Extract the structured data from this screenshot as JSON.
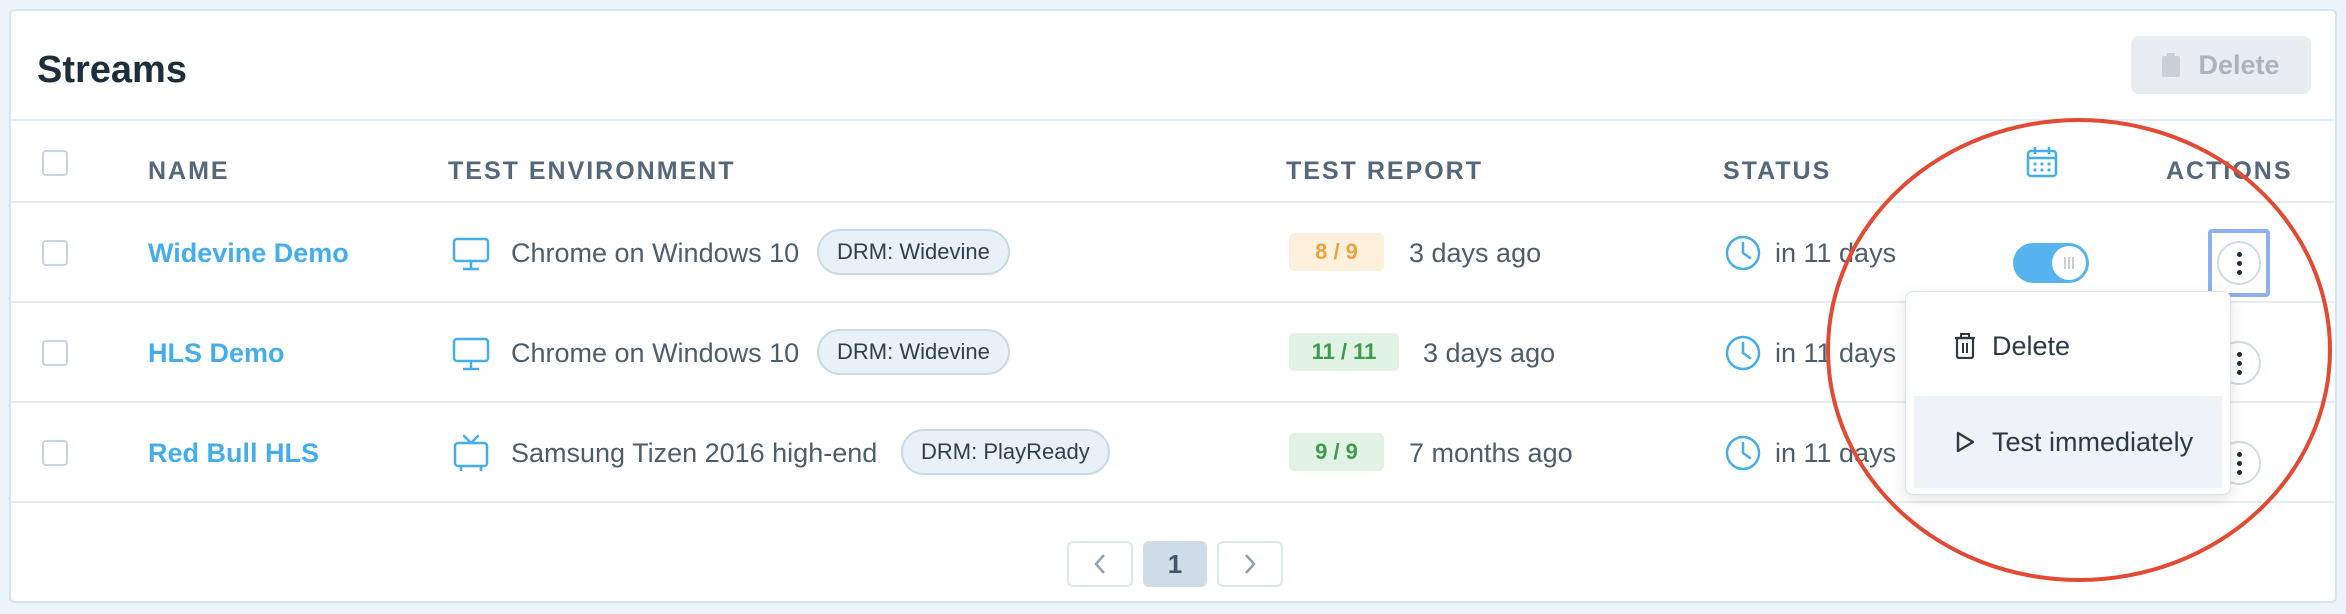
{
  "panel": {
    "title": "Streams",
    "delete_label": "Delete"
  },
  "columns": {
    "name": "NAME",
    "env": "TEST ENVIRONMENT",
    "report": "TEST REPORT",
    "status": "STATUS",
    "actions": "ACTIONS"
  },
  "rows": [
    {
      "name": "Widevine Demo",
      "env_icon": "monitor-icon",
      "env": "Chrome on Windows 10",
      "drm": "DRM: Widevine",
      "score": "8 / 9",
      "score_state": "warning",
      "ago": "3 days ago",
      "status": "in 11 days"
    },
    {
      "name": "HLS Demo",
      "env_icon": "monitor-icon",
      "env": "Chrome on Windows 10",
      "drm": "DRM: Widevine",
      "score": "11 / 11",
      "score_state": "pass",
      "ago": "3 days ago",
      "status": "in 11 days"
    },
    {
      "name": "Red Bull HLS",
      "env_icon": "tv-icon",
      "env": "Samsung Tizen 2016 high-end",
      "drm": "DRM: PlayReady",
      "score": "9 / 9",
      "score_state": "pass",
      "ago": "7 months ago",
      "status": "in 11 days"
    }
  ],
  "menu": {
    "delete": "Delete",
    "test_now": "Test immediately"
  },
  "pagination": {
    "current": "1"
  },
  "colors": {
    "accent": "#45aeea",
    "toggle_on": "#56b3ef",
    "warning": "#eda33b",
    "pass": "#3f9a51",
    "annotation": "#e24a33"
  }
}
